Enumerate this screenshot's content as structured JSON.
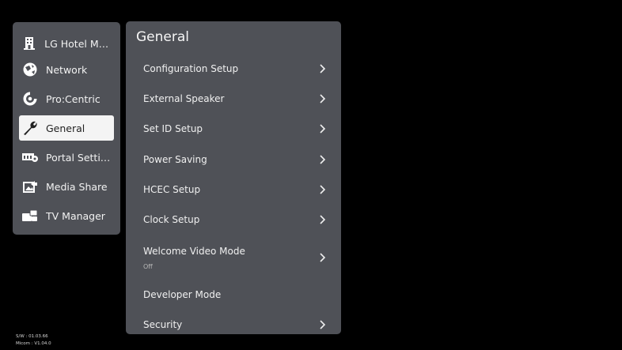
{
  "sidebar": {
    "items": [
      {
        "label": "LG Hotel Mod...",
        "icon": "building-icon",
        "selected": false
      },
      {
        "label": "Network",
        "icon": "network-globe-icon",
        "selected": false
      },
      {
        "label": "Pro:Centric",
        "icon": "procentric-icon",
        "selected": false
      },
      {
        "label": "General",
        "icon": "wrench-icon",
        "selected": true
      },
      {
        "label": "Portal Settings",
        "icon": "portal-settings-icon",
        "selected": false
      },
      {
        "label": "Media Share",
        "icon": "media-share-icon",
        "selected": false
      },
      {
        "label": "TV Manager",
        "icon": "tv-manager-icon",
        "selected": false
      }
    ]
  },
  "panel": {
    "title": "General",
    "items": [
      {
        "label": "Configuration Setup",
        "chevron": true
      },
      {
        "label": "External Speaker",
        "chevron": true
      },
      {
        "label": "Set ID Setup",
        "chevron": true
      },
      {
        "label": "Power Saving",
        "chevron": true
      },
      {
        "label": "HCEC Setup",
        "chevron": true
      },
      {
        "label": "Clock Setup",
        "chevron": true
      },
      {
        "label": "Welcome Video Mode",
        "sub": "Off",
        "chevron": true
      },
      {
        "label": "Developer Mode",
        "chevron": false
      },
      {
        "label": "Security",
        "chevron": true
      }
    ]
  },
  "footer": {
    "sw": "S/W : 01.03.66",
    "micom": "Micom : V1.04.0"
  }
}
